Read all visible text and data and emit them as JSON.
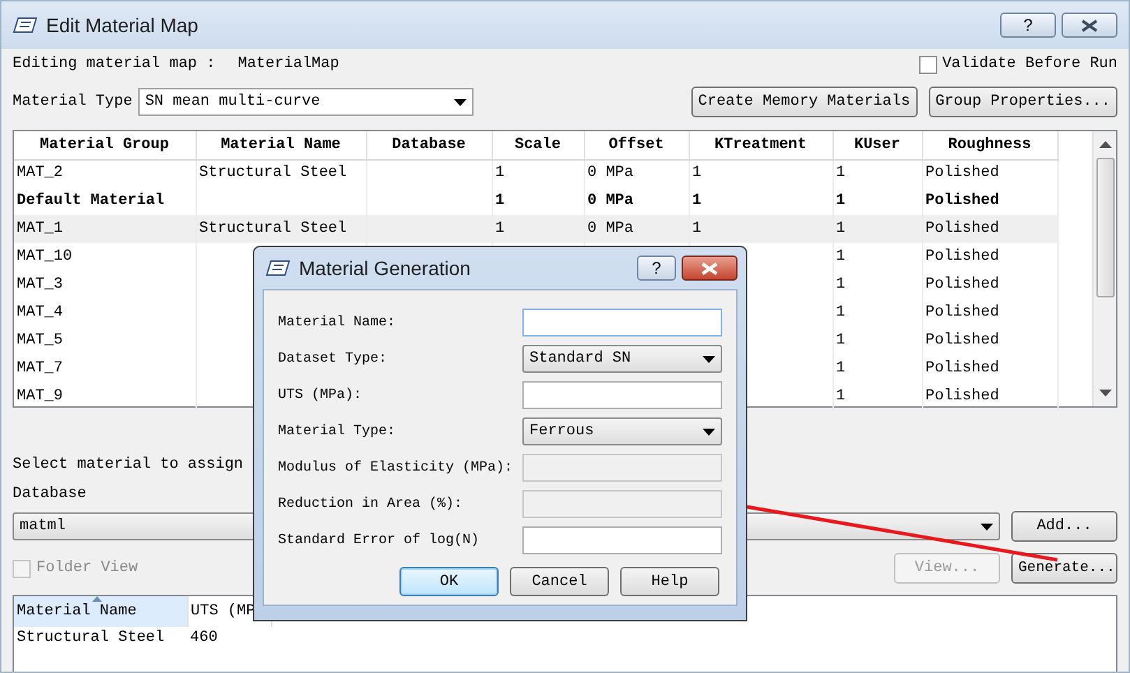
{
  "window": {
    "title": "Edit Material Map",
    "help": "?"
  },
  "map_label": "Editing material map :",
  "map_name": "MaterialMap",
  "validate": {
    "label": "Validate Before Run",
    "checked": false
  },
  "material_type": {
    "label": "Material Type",
    "value": "SN mean multi-curve"
  },
  "buttons": [
    "Create Memory Materials",
    "Group Properties..."
  ],
  "table": {
    "columns": [
      "Material Group",
      "Material Name",
      "Database",
      "Scale",
      "Offset",
      "KTreatment",
      "KUser",
      "Roughness"
    ],
    "rows": [
      {
        "group": "MAT_2",
        "name": "Structural Steel",
        "scale": "1",
        "offset": "0 MPa",
        "ktreatment": "1",
        "kuser": "1",
        "roughness": "Polished",
        "bold": false,
        "selected": false
      },
      {
        "group": "Default Material",
        "scale": "1",
        "offset": "0 MPa",
        "ktreatment": "1",
        "kuser": "1",
        "roughness": "Polished",
        "bold": true,
        "selected": false
      },
      {
        "group": "MAT_1",
        "name": "Structural Steel",
        "scale": "1",
        "offset": "0 MPa",
        "ktreatment": "1",
        "kuser": "1",
        "roughness": "Polished",
        "bold": false,
        "selected": true
      },
      {
        "group": "MAT_10",
        "kuser": "1",
        "roughness": "Polished",
        "bold": false,
        "selected": false
      },
      {
        "group": "MAT_3",
        "kuser": "1",
        "roughness": "Polished",
        "bold": false,
        "selected": false
      },
      {
        "group": "MAT_4",
        "kuser": "1",
        "roughness": "Polished",
        "bold": false,
        "selected": false
      },
      {
        "group": "MAT_5",
        "kuser": "1",
        "roughness": "Polished",
        "bold": false,
        "selected": false
      },
      {
        "group": "MAT_7",
        "kuser": "1",
        "roughness": "Polished",
        "bold": false,
        "selected": false
      },
      {
        "group": "MAT_9",
        "kuser": "1",
        "roughness": "Polished",
        "bold": false,
        "selected": false
      }
    ]
  },
  "select_label": "Select material to assign",
  "database": {
    "label": "Database",
    "value": "matml"
  },
  "add_button": "Add...",
  "folder_view": {
    "label": "Folder View",
    "checked": false,
    "disabled": true
  },
  "view_button": {
    "label": "View...",
    "disabled": true
  },
  "generate_button": {
    "label": "Generate...",
    "disabled": false
  },
  "materials_table": {
    "columns": [
      {
        "label": "Material Name",
        "sorted": true
      },
      {
        "label": "UTS (MP",
        "sorted": false
      }
    ],
    "rows": [
      [
        "Structural Steel",
        "460"
      ]
    ]
  },
  "dialog": {
    "title": "Material Generation",
    "help": "?",
    "fields": [
      {
        "label": "Material Name:",
        "kind": "input",
        "disabled": false
      },
      {
        "label": "Dataset Type:",
        "kind": "select",
        "value": "Standard SN"
      },
      {
        "label": "UTS (MPa):",
        "kind": "input",
        "disabled": false
      },
      {
        "label": "Material Type:",
        "kind": "select",
        "value": "Ferrous"
      },
      {
        "label": "Modulus of Elasticity (MPa):",
        "kind": "input",
        "disabled": true
      },
      {
        "label": "Reduction in Area (%):",
        "kind": "input",
        "disabled": true
      },
      {
        "label": "Standard Error of log(N)",
        "kind": "input",
        "disabled": false
      }
    ],
    "buttons": [
      {
        "label": "OK",
        "default": true
      },
      {
        "label": "Cancel",
        "default": false
      },
      {
        "label": "Help",
        "default": false
      }
    ]
  }
}
